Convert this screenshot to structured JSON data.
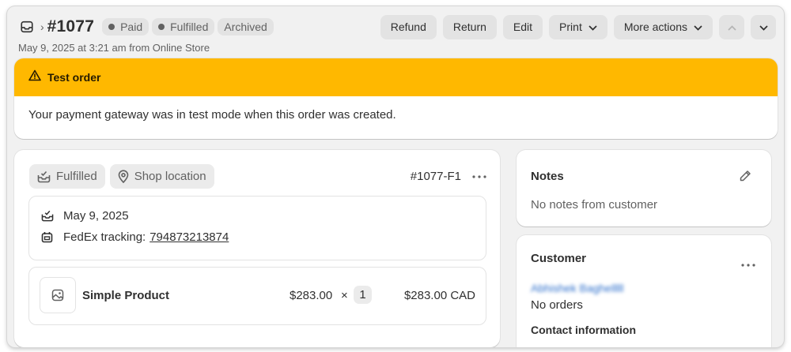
{
  "header": {
    "order_number": "#1077",
    "badges": [
      "Paid",
      "Fulfilled",
      "Archived"
    ],
    "actions": {
      "refund": "Refund",
      "return": "Return",
      "edit": "Edit",
      "print": "Print",
      "more": "More actions"
    },
    "subtitle": "May 9, 2025 at 3:21 am from Online Store"
  },
  "test_banner": {
    "title": "Test order",
    "message": "Your payment gateway was in test mode when this order was created.",
    "color": "#ffb800"
  },
  "fulfillment": {
    "status_label": "Fulfilled",
    "location_label": "Shop location",
    "fulfillment_id": "#1077-F1",
    "date": "May 9, 2025",
    "tracking_label": "FedEx tracking:",
    "tracking_number": "794873213874",
    "line_item": {
      "name": "Simple Product",
      "unit_price": "$283.00",
      "times": "×",
      "quantity": "1",
      "total": "$283.00 CAD"
    }
  },
  "notes": {
    "title": "Notes",
    "text": "No notes from customer"
  },
  "customer": {
    "title": "Customer",
    "name": "Abhishek Baghelllll",
    "orders": "No orders",
    "contact_title": "Contact information"
  },
  "icons": {
    "header": "inbox-icon",
    "breadcrumb": "chevron-right-icon",
    "warning": "alert-triangle-icon",
    "fulfilled": "package-fulfilled-icon",
    "location": "location-pin-icon",
    "calendar": "delivery-icon",
    "tracking": "tracking-icon",
    "product": "image-placeholder-icon",
    "edit": "pencil-icon",
    "more": "horizontal-dots-icon"
  }
}
